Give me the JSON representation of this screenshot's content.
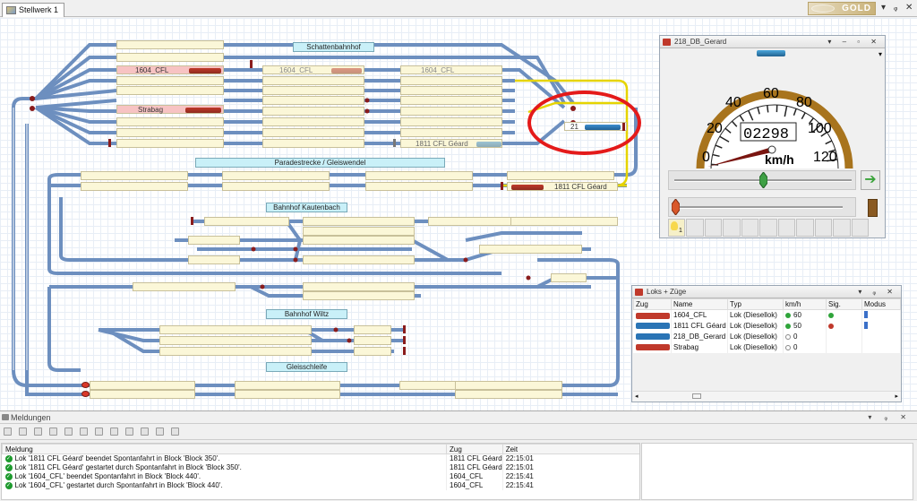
{
  "tab": {
    "label": "Stellwerk 1"
  },
  "brand": {
    "label": "GOLD"
  },
  "track_labels": {
    "schattenbahnhof": "Schattenbahnhof",
    "paradestrecke": "Paradestrecke / Gleiswendel",
    "kautenbach": "Bahnhof Kautenbach",
    "wiltz": "Bahnhof Wiltz",
    "gleisschleife": "Gleisschleife"
  },
  "blocks": {
    "b1604_left": "1604_CFL",
    "b1604_mid": "1604_CFL",
    "b1604_right": "1604_CFL",
    "strabag": "Strabag",
    "b1811_top": "1811 CFL Géard",
    "b1811_para": "1811 CFL Géard",
    "b21": "21"
  },
  "speed_panel": {
    "title": "218_DB_Gerard",
    "odometer": "02298",
    "unit": "km/h",
    "ticks": [
      "0",
      "20",
      "40",
      "60",
      "80",
      "100",
      "120"
    ],
    "speed_kmh": 0,
    "func_label": "1"
  },
  "loks_panel": {
    "title": "Loks + Züge",
    "columns": [
      "Zug",
      "Name",
      "Typ",
      "km/h",
      "Sig.",
      "Modus"
    ],
    "rows": [
      {
        "name": "1604_CFL",
        "typ": "Lok (Diesellok)",
        "kmh": "60",
        "color": "#c0392b",
        "dot": "#2fa43a",
        "sig": "#2fa43a"
      },
      {
        "name": "1811 CFL Géard",
        "typ": "Lok (Diesellok)",
        "kmh": "50",
        "color": "#2a74b5",
        "dot": "#2fa43a",
        "sig": "#c0392b"
      },
      {
        "name": "218_DB_Gerard",
        "typ": "Lok (Diesellok)",
        "kmh": "0",
        "color": "#2a74b5",
        "dot": "#ffffff",
        "sig": ""
      },
      {
        "name": "Strabag",
        "typ": "Lok (Diesellok)",
        "kmh": "0",
        "color": "#c0392b",
        "dot": "#ffffff",
        "sig": ""
      }
    ]
  },
  "messages": {
    "title": "Meldungen",
    "columns": [
      "Meldung",
      "Zug",
      "Zeit"
    ],
    "rows": [
      {
        "text": "Lok '1811 CFL Géard' beendet Spontanfahrt in Block 'Block 350'.",
        "zug": "1811 CFL Géard",
        "zeit": "22:15:01"
      },
      {
        "text": "Lok '1811 CFL Géard' gestartet durch Spontanfahrt in Block 'Block 350'.",
        "zug": "1811 CFL Géard",
        "zeit": "22:15:01"
      },
      {
        "text": "Lok '1604_CFL' beendet Spontanfahrt in Block 'Block 440'.",
        "zug": "1604_CFL",
        "zeit": "22:15:41"
      },
      {
        "text": "Lok '1604_CFL' gestartet durch Spontanfahrt in Block 'Block 440'.",
        "zug": "1604_CFL",
        "zeit": "22:15:41"
      }
    ]
  },
  "colors": {
    "track": "#6d8fbf",
    "highlight_track": "#e6d400",
    "accent_red": "#e41a1a"
  }
}
